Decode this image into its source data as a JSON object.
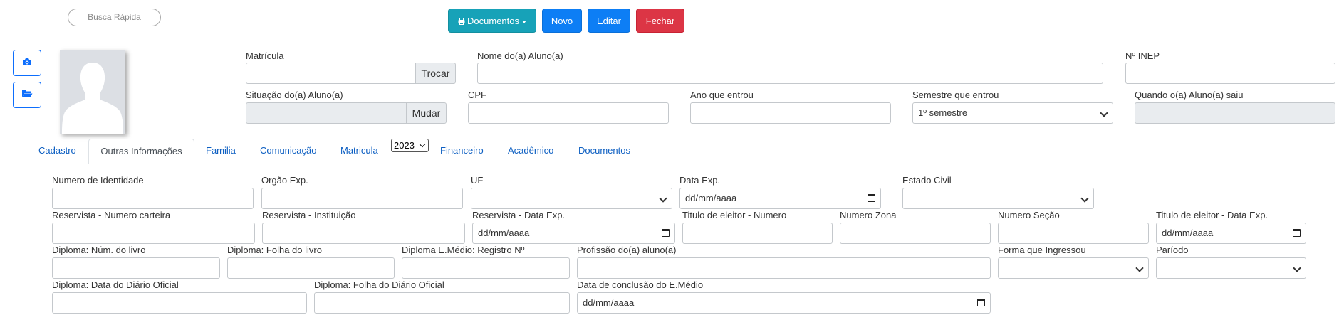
{
  "header": {
    "quick_search": "Busca Rápida",
    "buttons": {
      "documents": "Documentos",
      "new": "Novo",
      "edit": "Editar",
      "close": "Fechar"
    },
    "documents_icon": "printer-icon"
  },
  "sidebar": {
    "camera_icon": "camera-icon",
    "folder_icon": "folder-open-icon"
  },
  "photo": {
    "icon": "avatar-silhouette"
  },
  "top_form": {
    "matricula": {
      "label": "Matrícula",
      "value": "",
      "button": "Trocar"
    },
    "nome": {
      "label": "Nome do(a) Aluno(a)",
      "value": ""
    },
    "inep": {
      "label": "Nº INEP",
      "value": ""
    },
    "situacao": {
      "label": "Situação do(a) Aluno(a)",
      "value": "",
      "button": "Mudar"
    },
    "cpf": {
      "label": "CPF",
      "value": ""
    },
    "ano_entrou": {
      "label": "Ano que entrou",
      "value": ""
    },
    "semestre": {
      "label": "Semestre que entrou",
      "value": "1º semestre"
    },
    "quando_saiu": {
      "label": "Quando o(a) Aluno(a) saiu",
      "value": ""
    }
  },
  "tabs": {
    "cadastro": "Cadastro",
    "outras": "Outras Informações",
    "familia": "Familia",
    "comunicacao": "Comunicação",
    "matricula": "Matricula",
    "year": "2023",
    "financeiro": "Financeiro",
    "academico": "Acadêmico",
    "documentos": "Documentos"
  },
  "fields": {
    "identidade": {
      "label": "Numero de Identidade",
      "value": ""
    },
    "orgao_exp": {
      "label": "Orgão Exp.",
      "value": ""
    },
    "uf": {
      "label": "UF",
      "value": ""
    },
    "data_exp": {
      "label": "Data Exp.",
      "value": "dd/mm/aaaa"
    },
    "estado_civil": {
      "label": "Estado Civil",
      "value": ""
    },
    "reservista_numero": {
      "label": "Reservista - Numero carteira",
      "value": ""
    },
    "reservista_instituicao": {
      "label": "Reservista - Instituição",
      "value": ""
    },
    "reservista_data": {
      "label": "Reservista - Data Exp.",
      "value": "dd/mm/aaaa"
    },
    "titulo_numero": {
      "label": "Titulo de eleitor - Numero",
      "value": ""
    },
    "numero_zona": {
      "label": "Numero Zona",
      "value": ""
    },
    "numero_secao": {
      "label": "Numero Seção",
      "value": ""
    },
    "titulo_data": {
      "label": "Titulo de eleitor - Data Exp.",
      "value": "dd/mm/aaaa"
    },
    "diploma_livro": {
      "label": "Diploma: Núm. do livro",
      "value": ""
    },
    "diploma_folha": {
      "label": "Diploma: Folha do livro",
      "value": ""
    },
    "diploma_registro": {
      "label": "Diploma E.Médio: Registro Nº",
      "value": ""
    },
    "profissao": {
      "label": "Profissão do(a) aluno(a)",
      "value": ""
    },
    "forma_ingresso": {
      "label": "Forma que Ingressou",
      "value": ""
    },
    "periodo": {
      "label": "Paríodo",
      "value": ""
    },
    "diploma_data_diario": {
      "label": "Diploma: Data do Diário Oficial",
      "value": ""
    },
    "diploma_folha_diario": {
      "label": "Diploma: Folha do Diário Oficial",
      "value": ""
    },
    "data_conclusao": {
      "label": "Data de conclusão do E.Médio",
      "value": "dd/mm/aaaa"
    }
  }
}
